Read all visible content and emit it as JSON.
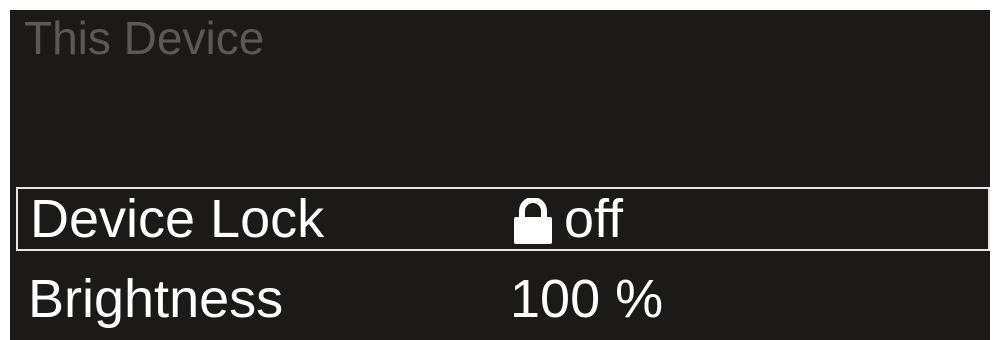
{
  "screen": {
    "title": "This Device"
  },
  "menu": {
    "items": [
      {
        "label": "Device Lock",
        "value": "off",
        "icon": "lock-icon",
        "selected": true
      },
      {
        "label": "Brightness",
        "value": "100 %",
        "selected": false
      }
    ]
  },
  "colors": {
    "background": "#1b1a18",
    "title_text": "#5a5957",
    "text": "#ffffff",
    "selection_border": "#e6e6e6"
  }
}
